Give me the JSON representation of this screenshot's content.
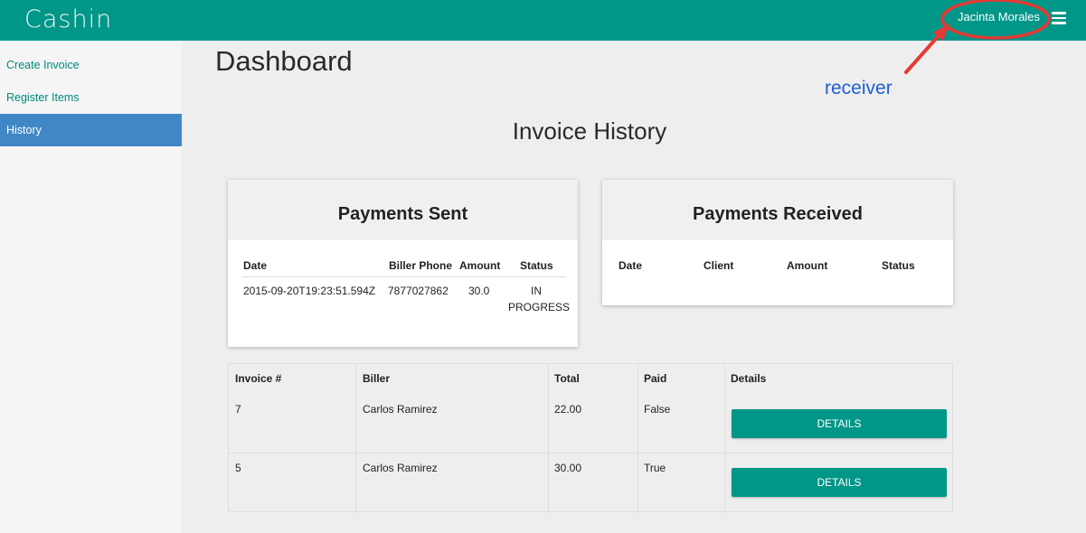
{
  "header": {
    "brand": "Cashin",
    "user_name": "Jacinta Morales",
    "menu_icon": "hamburger-menu-icon",
    "bg_color": "#009688"
  },
  "sidebar": {
    "items": [
      {
        "label": "Create Invoice",
        "active": false
      },
      {
        "label": "Register Items",
        "active": false
      },
      {
        "label": "History",
        "active": true
      }
    ]
  },
  "annotation": {
    "label": "receiver",
    "color": "#e53935"
  },
  "main": {
    "title": "Dashboard",
    "section_title": "Invoice History"
  },
  "payments_sent": {
    "title": "Payments Sent",
    "columns": [
      "Date",
      "Biller Phone",
      "Amount",
      "Status"
    ],
    "rows": [
      {
        "date": "2015-09-20T19:23:51.594Z",
        "biller_phone": "7877027862",
        "amount": "30.0",
        "status_1": "IN",
        "status_2": "PROGRESS"
      }
    ]
  },
  "payments_received": {
    "title": "Payments Received",
    "columns": [
      "Date",
      "Client",
      "Amount",
      "Status"
    ]
  },
  "invoices": {
    "columns": [
      "Invoice #",
      "Biller",
      "Total",
      "Paid",
      "Details"
    ],
    "rows": [
      {
        "invoice": "7",
        "biller": "Carlos Ramirez",
        "total": "22.00",
        "paid": "False",
        "button": "DETAILS"
      },
      {
        "invoice": "5",
        "biller": "Carlos Ramirez",
        "total": "30.00",
        "paid": "True",
        "button": "DETAILS"
      }
    ]
  }
}
